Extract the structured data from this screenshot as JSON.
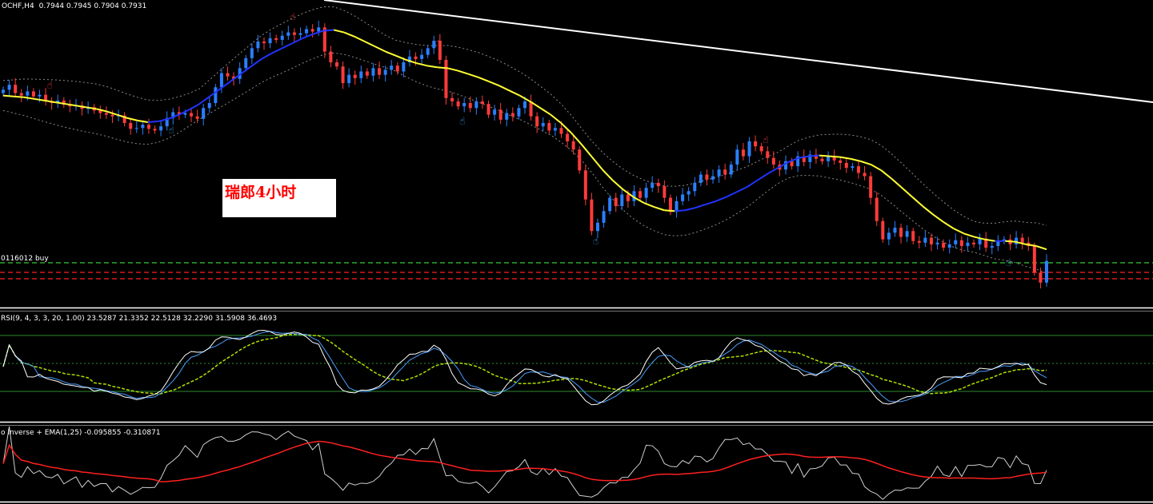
{
  "header": {
    "symbol": "OCHF,H4",
    "ohlc": "0.7944 0.7945 0.7904 0.7931"
  },
  "note_text": "瑞郎4小时",
  "order_label": "0116012 buy",
  "rsi_label": "RSI(9, 4, 3, 3, 20, 1.00) 23.5287 21.3352 22.5128 32.2290 31.5908 36.4693",
  "osc_label": "o Inverse + EMA(1,25) -0.095855 -0.310871",
  "colors": {
    "bull": "#2a7fff",
    "bear": "#ff3b3b",
    "ma_up": "#ffff33",
    "ma_down": "#2233ff",
    "band": "#8a8a8a",
    "trend": "#ffffff",
    "order_line": "#33cc33",
    "sl_line": "#ff2222",
    "rsi_main": "#ffffff",
    "rsi_signal": "#b0e000",
    "osc_line": "#cfcfcf",
    "osc_ema": "#ff2020"
  },
  "chart_data": [
    {
      "type": "candlestick",
      "title": "OCHF,H4",
      "close": [
        0.7952,
        0.7958,
        0.7948,
        0.7945,
        0.795,
        0.7944,
        0.7946,
        0.7938,
        0.7936,
        0.7939,
        0.7934,
        0.7932,
        0.7933,
        0.7929,
        0.7931,
        0.7927,
        0.7924,
        0.7922,
        0.792,
        0.7921,
        0.7912,
        0.7905,
        0.7906,
        0.791,
        0.7905,
        0.7903,
        0.7908,
        0.7918,
        0.7925,
        0.7922,
        0.7924,
        0.792,
        0.7917,
        0.793,
        0.7936,
        0.7955,
        0.7972,
        0.7968,
        0.7965,
        0.7978,
        0.799,
        0.8002,
        0.801,
        0.8008,
        0.8014,
        0.8012,
        0.8017,
        0.8021,
        0.8018,
        0.802,
        0.8025,
        0.8022,
        0.8027,
        0.7998,
        0.7985,
        0.798,
        0.796,
        0.797,
        0.7966,
        0.7974,
        0.7969,
        0.7978,
        0.797,
        0.7976,
        0.7981,
        0.7974,
        0.7985,
        0.7992,
        0.7989,
        0.7994,
        0.8002,
        0.8011,
        0.7988,
        0.7942,
        0.7938,
        0.7932,
        0.7936,
        0.793,
        0.7938,
        0.7935,
        0.7922,
        0.7928,
        0.7916,
        0.7924,
        0.792,
        0.793,
        0.7938,
        0.792,
        0.7908,
        0.7912,
        0.7903,
        0.7906,
        0.7899,
        0.789,
        0.788,
        0.7855,
        0.782,
        0.7782,
        0.7792,
        0.7806,
        0.7822,
        0.7812,
        0.7826,
        0.7818,
        0.783,
        0.7822,
        0.7834,
        0.784,
        0.7836,
        0.7822,
        0.7805,
        0.7818,
        0.7826,
        0.783,
        0.784,
        0.785,
        0.7844,
        0.7848,
        0.7856,
        0.785,
        0.7862,
        0.788,
        0.7872,
        0.789,
        0.7884,
        0.7878,
        0.787,
        0.7862,
        0.7856,
        0.7866,
        0.786,
        0.7872,
        0.7865,
        0.7874,
        0.7869,
        0.7866,
        0.7872,
        0.7867,
        0.7864,
        0.7858,
        0.786,
        0.7852,
        0.7848,
        0.7822,
        0.7794,
        0.7772,
        0.778,
        0.7786,
        0.7775,
        0.7782,
        0.777,
        0.7768,
        0.7774,
        0.7766,
        0.7768,
        0.7762,
        0.7766,
        0.7771,
        0.7764,
        0.7768,
        0.7766,
        0.7773,
        0.7762,
        0.7764,
        0.777,
        0.7772,
        0.7766,
        0.7774,
        0.7768,
        0.7764,
        0.7732,
        0.772,
        0.7746
      ],
      "ma": [
        0.7945,
        0.7944,
        0.7943,
        0.7941,
        0.7939,
        0.7937,
        0.7935,
        0.7933,
        0.7931,
        0.7929,
        0.7926,
        0.7922,
        0.7918,
        0.7915,
        0.7913,
        0.7914,
        0.7917,
        0.7922,
        0.7928,
        0.7935,
        0.7944,
        0.7953,
        0.7962,
        0.7971,
        0.798,
        0.7989,
        0.7996,
        0.8002,
        0.8008,
        0.8014,
        0.8019,
        0.8023,
        0.8024,
        0.8021,
        0.8016,
        0.801,
        0.8004,
        0.7998,
        0.7993,
        0.7988,
        0.7984,
        0.7981,
        0.7979,
        0.7978,
        0.7975,
        0.7971,
        0.7967,
        0.7962,
        0.7957,
        0.7951,
        0.7945,
        0.7938,
        0.793,
        0.7922,
        0.7912,
        0.79,
        0.7886,
        0.7871,
        0.7856,
        0.7843,
        0.7832,
        0.7823,
        0.7816,
        0.7811,
        0.7807,
        0.7806,
        0.7807,
        0.781,
        0.7814,
        0.7818,
        0.7823,
        0.7829,
        0.7835,
        0.7843,
        0.7851,
        0.7858,
        0.7865,
        0.787,
        0.7872,
        0.7873,
        0.7872,
        0.7871,
        0.7869,
        0.7866,
        0.7862,
        0.7855,
        0.7845,
        0.7834,
        0.7823,
        0.7812,
        0.7802,
        0.7793,
        0.7785,
        0.7779,
        0.7775,
        0.7772,
        0.777,
        0.777,
        0.7769,
        0.7766,
        0.7764,
        0.776
      ],
      "ylim": [
        0.769,
        0.806
      ]
    },
    {
      "type": "line",
      "title": "RSI(9, 4, 3, 3, 20, 1.00)",
      "ylim": [
        0,
        100
      ],
      "levels": [
        80,
        50,
        20
      ],
      "values_last": [
        23.5287,
        21.3352,
        22.5128,
        32.229,
        31.5908,
        36.4693
      ]
    },
    {
      "type": "line",
      "title": "Inverse + EMA(1,25)",
      "values_last": [
        -0.095855,
        -0.310871
      ]
    }
  ]
}
